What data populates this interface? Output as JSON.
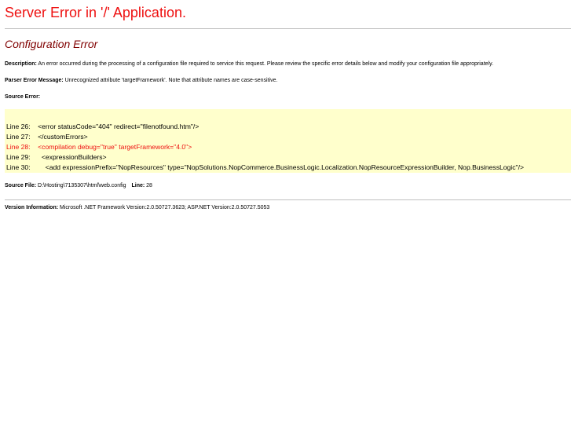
{
  "header": {
    "title": "Server Error in '/' Application."
  },
  "error": {
    "heading": "Configuration Error",
    "description_label": "Description:",
    "description_text": " An error occurred during the processing of a configuration file required to service this request. Please review the specific error details below and modify your configuration file appropriately.",
    "parser_label": "Parser Error Message:",
    "parser_text": " Unrecognized attribute 'targetFramework'. Note that attribute names are case-sensitive.",
    "source_error_label": "Source Error:"
  },
  "source_code": {
    "lines": [
      {
        "text": "Line 26:    <error statusCode=\"404\" redirect=\"filenotfound.htm\"/>",
        "highlight": false
      },
      {
        "text": "Line 27:    </customErrors>",
        "highlight": false
      },
      {
        "text": "Line 28:    <compilation debug=\"true\" targetFramework=\"4.0\">",
        "highlight": true
      },
      {
        "text": "Line 29:      <expressionBuilders>",
        "highlight": false
      },
      {
        "text": "Line 30:        <add expressionPrefix=\"NopResources\" type=\"NopSolutions.NopCommerce.BusinessLogic.Localization.NopResourceExpressionBuilder, Nop.BusinessLogic\"/>",
        "highlight": false
      }
    ]
  },
  "source_file": {
    "label": "Source File:",
    "path": " D:\\Hosting\\7135307\\html\\web.config",
    "line_label": "Line:",
    "line_value": " 28"
  },
  "version": {
    "label": "Version Information:",
    "text": " Microsoft .NET Framework Version:2.0.50727.3623; ASP.NET Version:2.0.50727.5053"
  },
  "colors": {
    "title": "#ee1111",
    "subtitle": "#800000",
    "code_background": "#ffffcc",
    "error_line": "#ee1111",
    "rule": "#c0c0c0"
  }
}
